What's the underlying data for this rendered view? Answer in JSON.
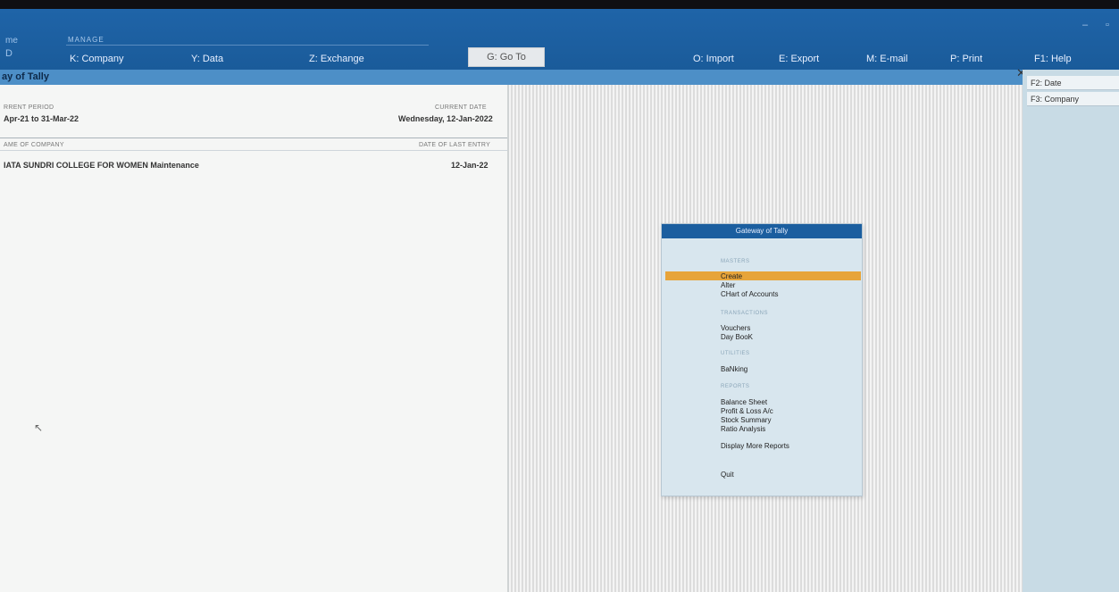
{
  "topbar": {
    "home_label": "me",
    "home_key": "D",
    "manage_label": "MANAGE",
    "menu": {
      "company": "K: Company",
      "data": "Y: Data",
      "exchange": "Z: Exchange",
      "goto": "G: Go To",
      "import": "O: Import",
      "export": "E: Export",
      "email": "M: E-mail",
      "print": "P: Print",
      "help": "F1: Help"
    },
    "window_controls": {
      "minimize": "–",
      "restore": "▫"
    }
  },
  "title_strip": {
    "title": "ay of Tally"
  },
  "left_panel": {
    "current_period_label": "RRENT PERIOD",
    "current_period": "Apr-21 to 31-Mar-22",
    "current_date_label": "CURRENT DATE",
    "current_date": "Wednesday, 12-Jan-2022",
    "name_of_company_label": "AME OF COMPANY",
    "date_of_last_entry_label": "DATE OF LAST ENTRY",
    "company_name": "IATA SUNDRI COLLEGE FOR WOMEN Maintenance",
    "last_entry_date": "12-Jan-22"
  },
  "gateway": {
    "title": "Gateway of Tally",
    "sections": {
      "masters": "MASTERS",
      "transactions": "TRANSACTIONS",
      "utilities": "UTILITIES",
      "reports": "REPORTS"
    },
    "items": {
      "create": "Create",
      "alter": "Alter",
      "chart_of_accounts": "CHart of Accounts",
      "vouchers": "Vouchers",
      "day_book": "Day BooK",
      "banking": "BaNking",
      "balance_sheet": "Balance Sheet",
      "profit_loss": "Profit & Loss A/c",
      "stock_summary": "Stock Summary",
      "ratio_analysis": "Ratio Analysis",
      "display_more": "Display More Reports",
      "quit": "Quit"
    }
  },
  "sidebar": {
    "close": "✕",
    "date": "F2: Date",
    "company": "F3: Company"
  },
  "colors": {
    "topbar": "#1f64a8",
    "title_strip": "#4d8fc7",
    "highlight": "#e7a43a",
    "gateway_bg": "#d8e6ee",
    "sidebar": "#c8dbe5"
  }
}
